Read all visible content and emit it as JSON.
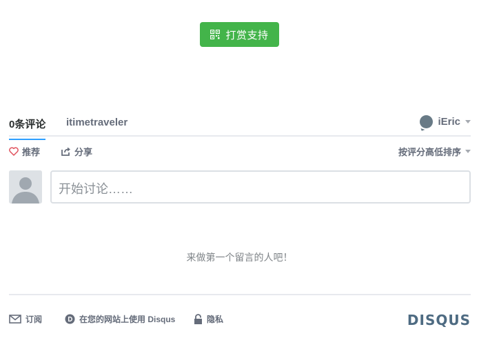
{
  "reward": {
    "label": "打赏支持",
    "color": "#43b44a"
  },
  "nav": {
    "comment_count": "0条评论",
    "forum": "itimetraveler",
    "user": "iEric"
  },
  "actions": {
    "recommend": "推荐",
    "share": "分享",
    "sort": "按评分高低排序"
  },
  "composer": {
    "placeholder": "开始讨论……"
  },
  "empty_message": "来做第一个留言的人吧！",
  "footer": {
    "subscribe": "订阅",
    "add_disqus": "在您的网站上使用 Disqus",
    "privacy": "隐私",
    "brand": "DISQUS"
  },
  "colors": {
    "accent": "#2e9fff",
    "heart": "#e0505c",
    "brand": "#4e6b82"
  }
}
